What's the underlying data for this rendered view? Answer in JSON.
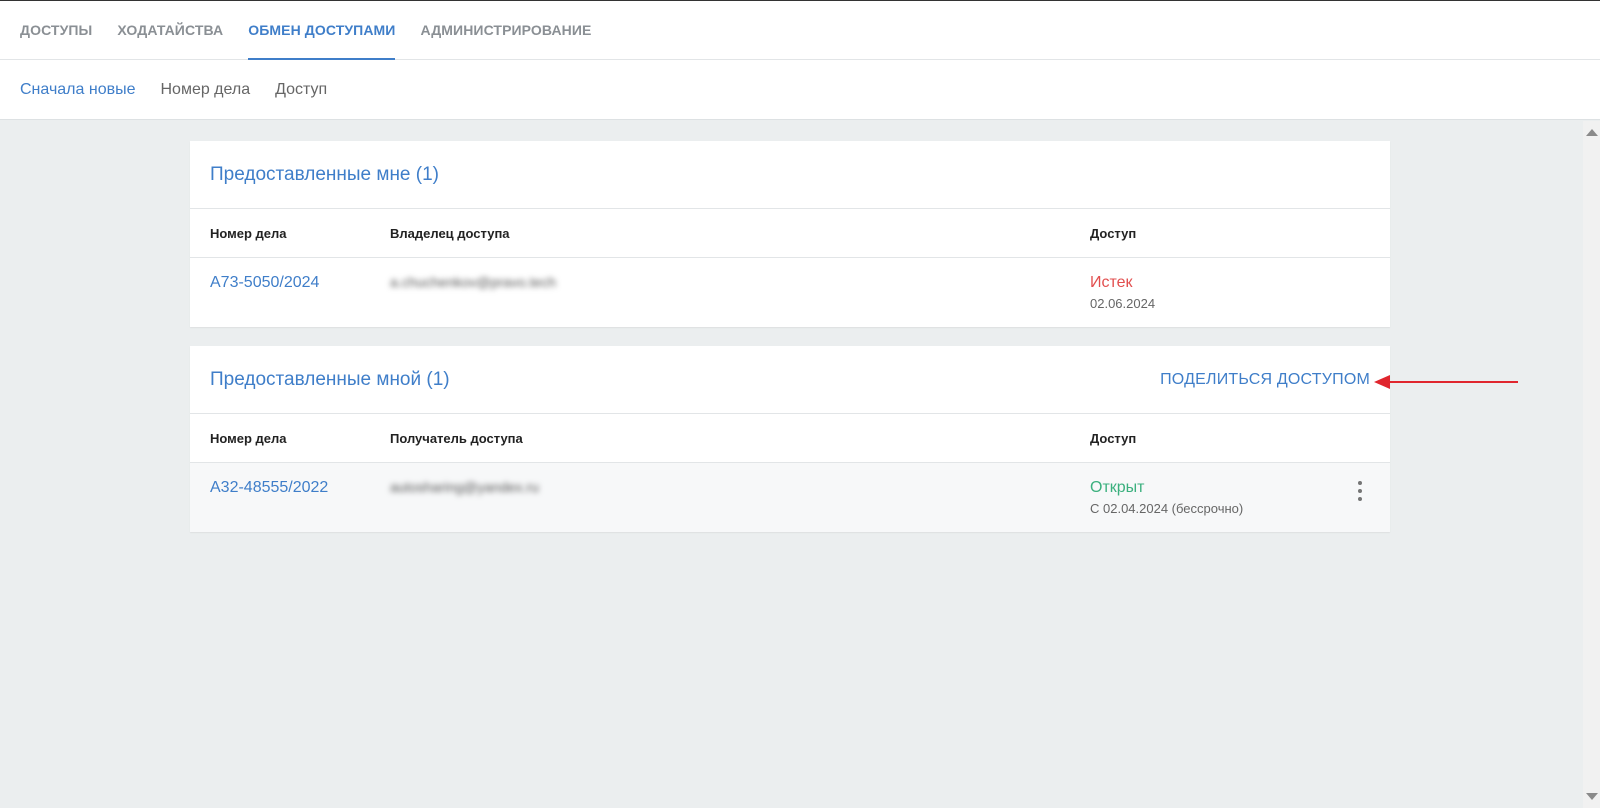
{
  "nav": {
    "tabs": [
      {
        "label": "ДОСТУПЫ"
      },
      {
        "label": "ХОДАТАЙСТВА"
      },
      {
        "label": "ОБМЕН ДОСТУПАМИ"
      },
      {
        "label": "АДМИНИСТРИРОВАНИЕ"
      }
    ],
    "active_tab": "ОБМЕН ДОСТУПАМИ"
  },
  "sort": {
    "options": [
      {
        "label": "Сначала новые"
      },
      {
        "label": "Номер дела"
      },
      {
        "label": "Доступ"
      }
    ],
    "active": "Сначала новые"
  },
  "granted_to_me": {
    "title": "Предоставленные мне (1)",
    "columns": [
      "Номер дела",
      "Владелец доступа",
      "Доступ"
    ],
    "rows": [
      {
        "case": "А73-5050/2024",
        "email": "a.chuchenkov@pravo.tech",
        "status": "Истек",
        "date": "02.06.2024"
      }
    ]
  },
  "granted_by_me": {
    "title": "Предоставленные мной (1)",
    "share_label": "ПОДЕЛИТЬСЯ ДОСТУПОМ",
    "columns": [
      "Номер дела",
      "Получатель доступа",
      "Доступ"
    ],
    "rows": [
      {
        "case": "А32-48555/2022",
        "email": "autosharing@yandex.ru",
        "status": "Открыт",
        "date": "С 02.04.2024 (бессрочно)"
      }
    ]
  },
  "colors": {
    "accent": "#3f7ec9",
    "expired": "#e24f4f",
    "open": "#3bb07e",
    "annotation_arrow": "#e0262e"
  },
  "icons": {
    "row_menu": "more-vertical-icon",
    "annotation": "red-arrow-icon"
  }
}
